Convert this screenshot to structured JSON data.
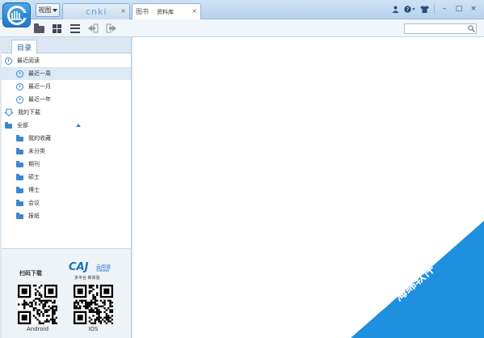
{
  "window": {
    "app_logo_icon": "cnki-logo-icon",
    "view_selector_glyph": "视图",
    "tabs": [
      {
        "id": "cnki",
        "label": "cnki",
        "close": "×"
      },
      {
        "id": "library",
        "icon": "图书",
        "label": "资料库",
        "close": "×"
      }
    ],
    "controls": {
      "user": "♙",
      "help": "?",
      "skin": "❖",
      "minimize": "–",
      "maximize": "□",
      "close": "×"
    }
  },
  "toolbar": {
    "search_placeholder": "",
    "search_icon": "search-icon"
  },
  "sidebar": {
    "tab_label": "目录",
    "tree": [
      {
        "label": "最近阅读",
        "icon": "clock-icon",
        "level": 0,
        "selected": false
      },
      {
        "label": "最近一周",
        "icon": "clock-icon",
        "level": 1,
        "selected": true
      },
      {
        "label": "最近一月",
        "icon": "clock-icon",
        "level": 1,
        "selected": false
      },
      {
        "label": "最近一年",
        "icon": "clock-icon",
        "level": 1,
        "selected": false
      },
      {
        "label": "我的下载",
        "icon": "download-icon",
        "level": 0,
        "selected": false
      },
      {
        "label": "全部",
        "icon": "folder-icon",
        "level": 0,
        "selected": false
      },
      {
        "label": "我的收藏",
        "icon": "folder-icon",
        "level": 1,
        "selected": false
      },
      {
        "label": "未分类",
        "icon": "folder-icon",
        "level": 1,
        "selected": false
      },
      {
        "label": "期刊",
        "icon": "folder-icon",
        "level": 1,
        "selected": false
      },
      {
        "label": "硕士",
        "icon": "folder-icon",
        "level": 1,
        "selected": false
      },
      {
        "label": "博士",
        "icon": "folder-icon",
        "level": 1,
        "selected": false
      },
      {
        "label": "会议",
        "icon": "folder-icon",
        "level": 1,
        "selected": false
      },
      {
        "label": "报纸",
        "icon": "folder-icon",
        "level": 1,
        "selected": false
      }
    ]
  },
  "promo": {
    "scan_label": "扫码下载",
    "caj_logo": "CAJ",
    "caj_cn": "云阅读",
    "caj_viewer": "Viewer",
    "caj_slogan": "多平台 新体验",
    "qr_android_label": "Android",
    "qr_ios_label": "IOS"
  },
  "watermark": {
    "text": "海绵软件"
  },
  "colors": {
    "accent": "#1f8fe0",
    "selection": "#dce9f7",
    "titlebar": "#c4daf0"
  }
}
